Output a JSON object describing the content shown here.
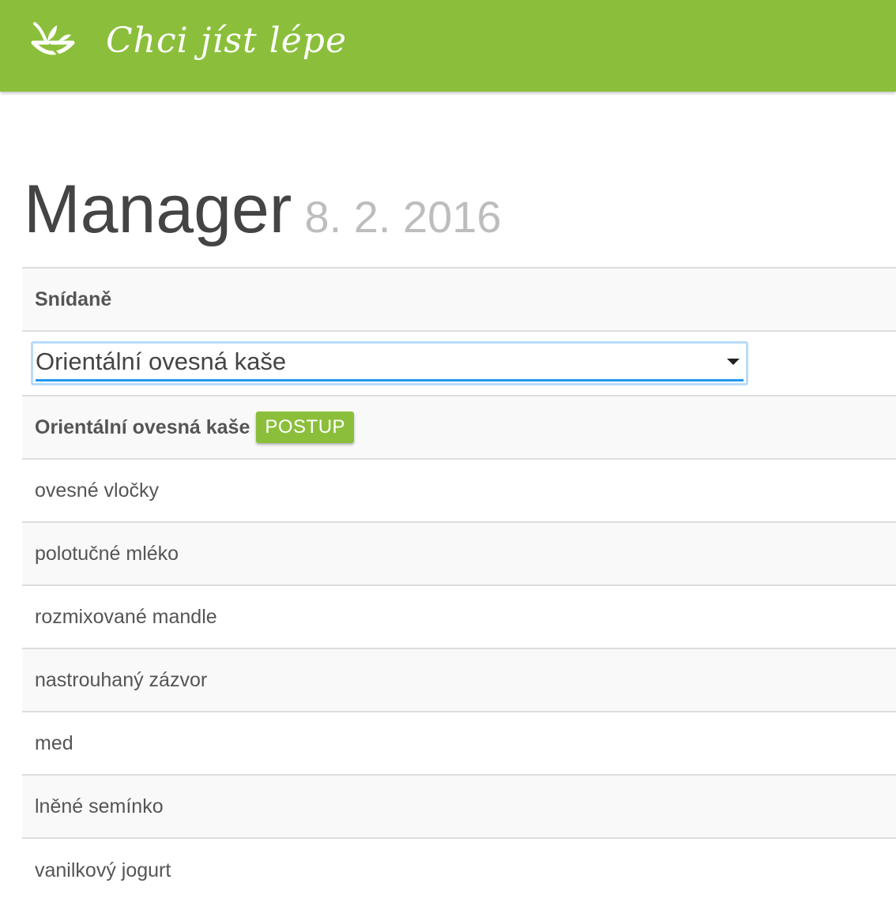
{
  "header": {
    "logo_text": "Chci jíst lépe",
    "logo_icon": "bowl-spoon-logo-icon",
    "background_color": "#8bbf3b"
  },
  "page": {
    "title": "Manager",
    "date": "8. 2. 2016"
  },
  "meal": {
    "section_label": "Snídaně",
    "selected_recipe": "Orientální ovesná kaše",
    "recipe_name": "Orientální ovesná kaše",
    "recipe_button_label": "POSTUP",
    "ingredients": [
      "ovesné vločky",
      "polotučné mléko",
      "rozmixované mandle",
      "nastrouhaný zázvor",
      "med",
      "lněné semínko",
      "vanilkový jogurt"
    ]
  },
  "colors": {
    "accent": "#8bbf3b",
    "focus_underline": "#2196f3",
    "focus_ring": "#b8dbfa"
  }
}
